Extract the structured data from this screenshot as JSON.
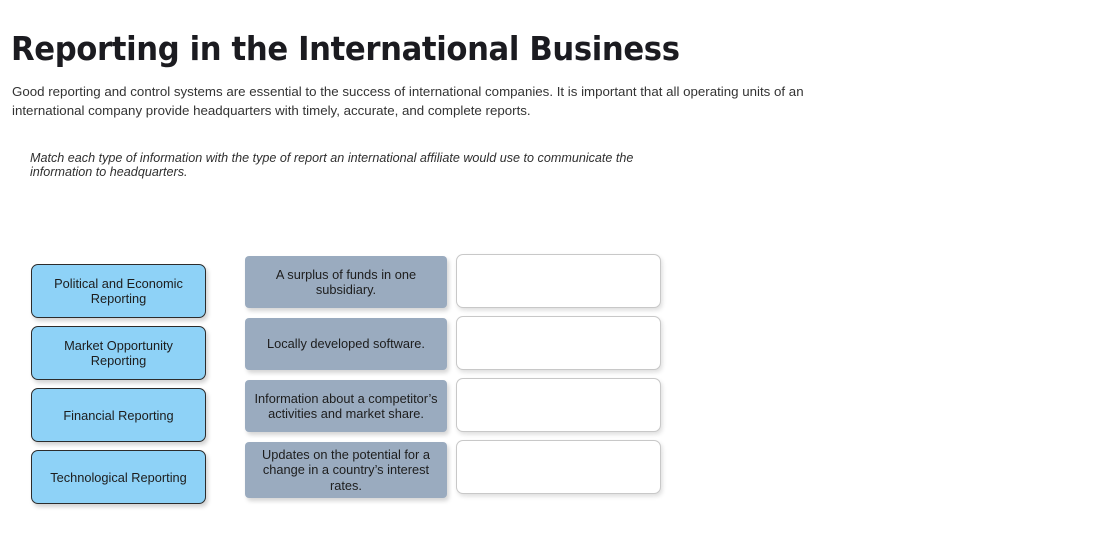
{
  "page": {
    "title": "Reporting in the International Business",
    "intro": "Good reporting and control systems are essential to the success of international companies. It is important that all operating units of an international company provide headquarters with timely, accurate, and complete reports.",
    "instruction": "Match each type of information with the type of report an international affiliate would use to communicate the information to headquarters."
  },
  "colors": {
    "category_fill": "#8ed2f7",
    "category_border": "#2c2c2c",
    "item_fill": "#9aabbf",
    "drop_border": "#c8c8c8",
    "title_color": "#1b1b20",
    "body_color": "#333333"
  },
  "match": {
    "categories": [
      {
        "label": "Political and Economic Reporting"
      },
      {
        "label": "Market Opportunity Reporting"
      },
      {
        "label": "Financial Reporting"
      },
      {
        "label": "Technological Reporting"
      }
    ],
    "items": [
      {
        "label": "A surplus of funds in one subsidiary."
      },
      {
        "label": "Locally developed software."
      },
      {
        "label": "Information about a competitor’s activities and market share."
      },
      {
        "label": "Updates on the potential for a change in a country’s interest rates."
      }
    ],
    "targets": [
      {
        "value": ""
      },
      {
        "value": ""
      },
      {
        "value": ""
      },
      {
        "value": ""
      }
    ]
  }
}
